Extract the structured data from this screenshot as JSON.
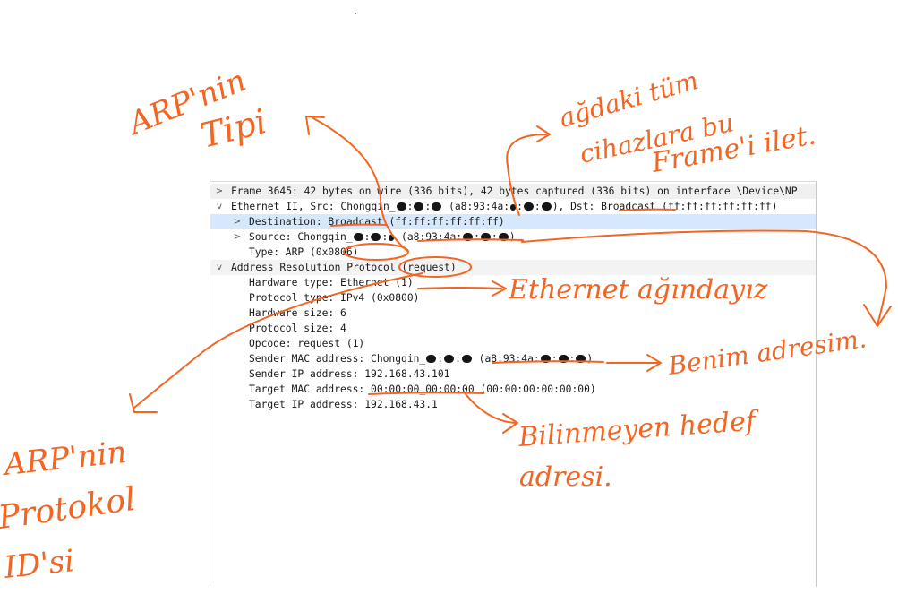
{
  "packet_details": {
    "frame": {
      "expand_glyph": ">",
      "text": "Frame 3645: 42 bytes on wire (336 bits), 42 bytes captured (336 bits) on interface \\Device\\NP"
    },
    "ethernet": {
      "expand_glyph": "v",
      "prefix": "Ethernet II, Src: Chongqin_",
      "mid": " (a8:93:4a:",
      "mid2": "), Dst: ",
      "dst_name": "Broadcast",
      "suffix": " (ff:ff:ff:ff:ff:ff)",
      "destination": {
        "expand_glyph": ">",
        "label": "Destination: ",
        "name": "Broadcast",
        "value": " (ff:ff:ff:ff:ff:ff)"
      },
      "source": {
        "expand_glyph": ">",
        "prefix": "Source: Chongqin_",
        "mid": " (a8:93:4a:",
        "suffix": ")"
      },
      "type": "Type: ARP (0x0806)"
    },
    "arp": {
      "expand_glyph": "v",
      "prefix": "Address Resolution Protocol ",
      "opcode_tag": "(request)",
      "fields": {
        "hardware_type": "Hardware type: Ethernet (1)",
        "protocol_type": "Protocol type: IPv4 (0x0800)",
        "hardware_size": "Hardware size: 6",
        "protocol_size": "Protocol size: 4",
        "opcode": "Opcode: request (1)",
        "sender_mac_prefix": "Sender MAC address: Chongqin_",
        "sender_mac_mid": " (a8:93:4a:",
        "sender_mac_suffix": ")",
        "sender_ip": "Sender IP address: 192.168.43.101",
        "target_mac_label": "Target MAC address: ",
        "target_mac_value": "00:00:00_00:00:00",
        "target_mac_suffix": " (00:00:00:00:00:00)",
        "target_ip": "Target IP address: 192.168.43.1"
      }
    }
  },
  "annotations": {
    "ink_color": "#f26522",
    "arp_type": {
      "line1": "ARP'nin",
      "line2": "Tipi"
    },
    "broadcast_note": {
      "line1": "ağdaki tüm",
      "line2": "cihazlara bu",
      "line3": "Frame'i ilet."
    },
    "ethernet_note": "Ethernet ağındayız",
    "sender_note": "Benim adresim.",
    "target_note": {
      "line1": "Bilinmeyen hedef",
      "line2": "adresi."
    },
    "protocol_id_note": {
      "line1": "ARP'nin",
      "line2": "Protokol",
      "line3": "ID'si"
    }
  }
}
